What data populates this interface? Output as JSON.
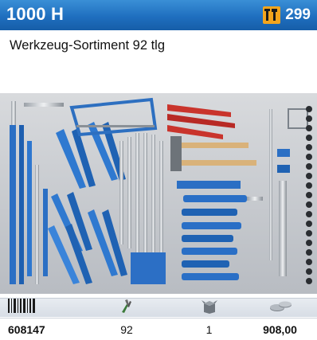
{
  "header": {
    "title": "1000 H",
    "page_number": "299",
    "icon": "tool-set-icon",
    "bar_color": "#1f6fbf",
    "badge_color": "#f4a51c"
  },
  "product": {
    "description": "Werkzeug-Sortiment 92 tlg",
    "image": "tool-assortment-photo"
  },
  "footer": {
    "icons": [
      "barcode-icon",
      "hand-tools-icon",
      "package-icon",
      "coins-icon"
    ],
    "values": {
      "article_number": "608147",
      "pieces": "92",
      "package_quantity": "1",
      "price": "908,00"
    }
  }
}
